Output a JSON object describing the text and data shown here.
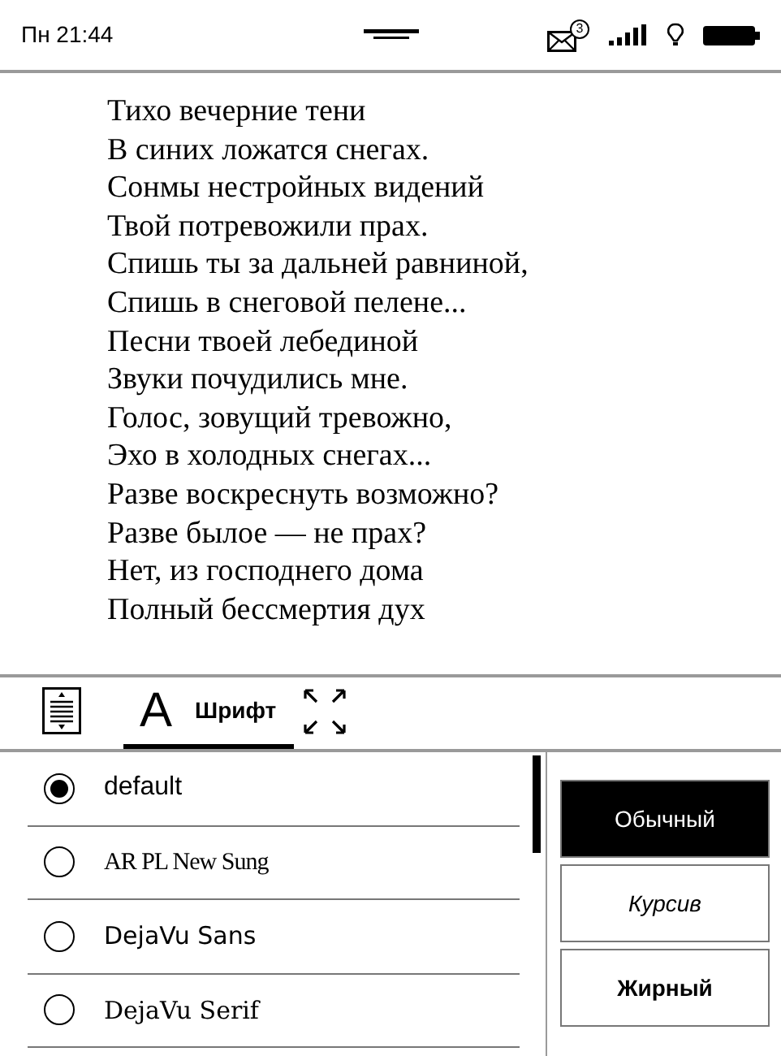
{
  "status_bar": {
    "time": "Пн 21:44",
    "notification_count": "3"
  },
  "poem": [
    "Тихо вечерние тени",
    "В синих ложатся снегах.",
    "Сонмы нестройных видений",
    "Твой потревожили прах.",
    "Спишь ты за дальней равниной,",
    "Спишь в снеговой пелене...",
    "Песни твоей лебединой",
    "Звуки почудились мне.",
    "Голос, зовущий тревожно,",
    "Эхо в холодных снегах...",
    "Разве воскреснуть возможно?",
    "Разве былое — не прах?",
    "Нет, из господнего дома",
    "Полный бессмертия дух"
  ],
  "tabs": [
    {
      "kind": "spacing",
      "selected": false
    },
    {
      "kind": "font",
      "icon": "A",
      "label": "Шрифт",
      "selected": true
    },
    {
      "kind": "fullscreen",
      "selected": false
    }
  ],
  "fonts": [
    {
      "label": "default",
      "kind": "sans",
      "selected": true
    },
    {
      "label": "AR PL New Sung",
      "kind": "narrow-serif",
      "selected": false
    },
    {
      "label": "DejaVu Sans",
      "kind": "dejavu-sans",
      "selected": false
    },
    {
      "label": "DejaVu Serif",
      "kind": "dejavu-serif",
      "selected": false
    }
  ],
  "styles": [
    {
      "label": "Обычный",
      "kind": "regular",
      "selected": true
    },
    {
      "label": "Курсив",
      "kind": "italic",
      "selected": false
    },
    {
      "label": "Жирный",
      "kind": "bold",
      "selected": false
    }
  ]
}
